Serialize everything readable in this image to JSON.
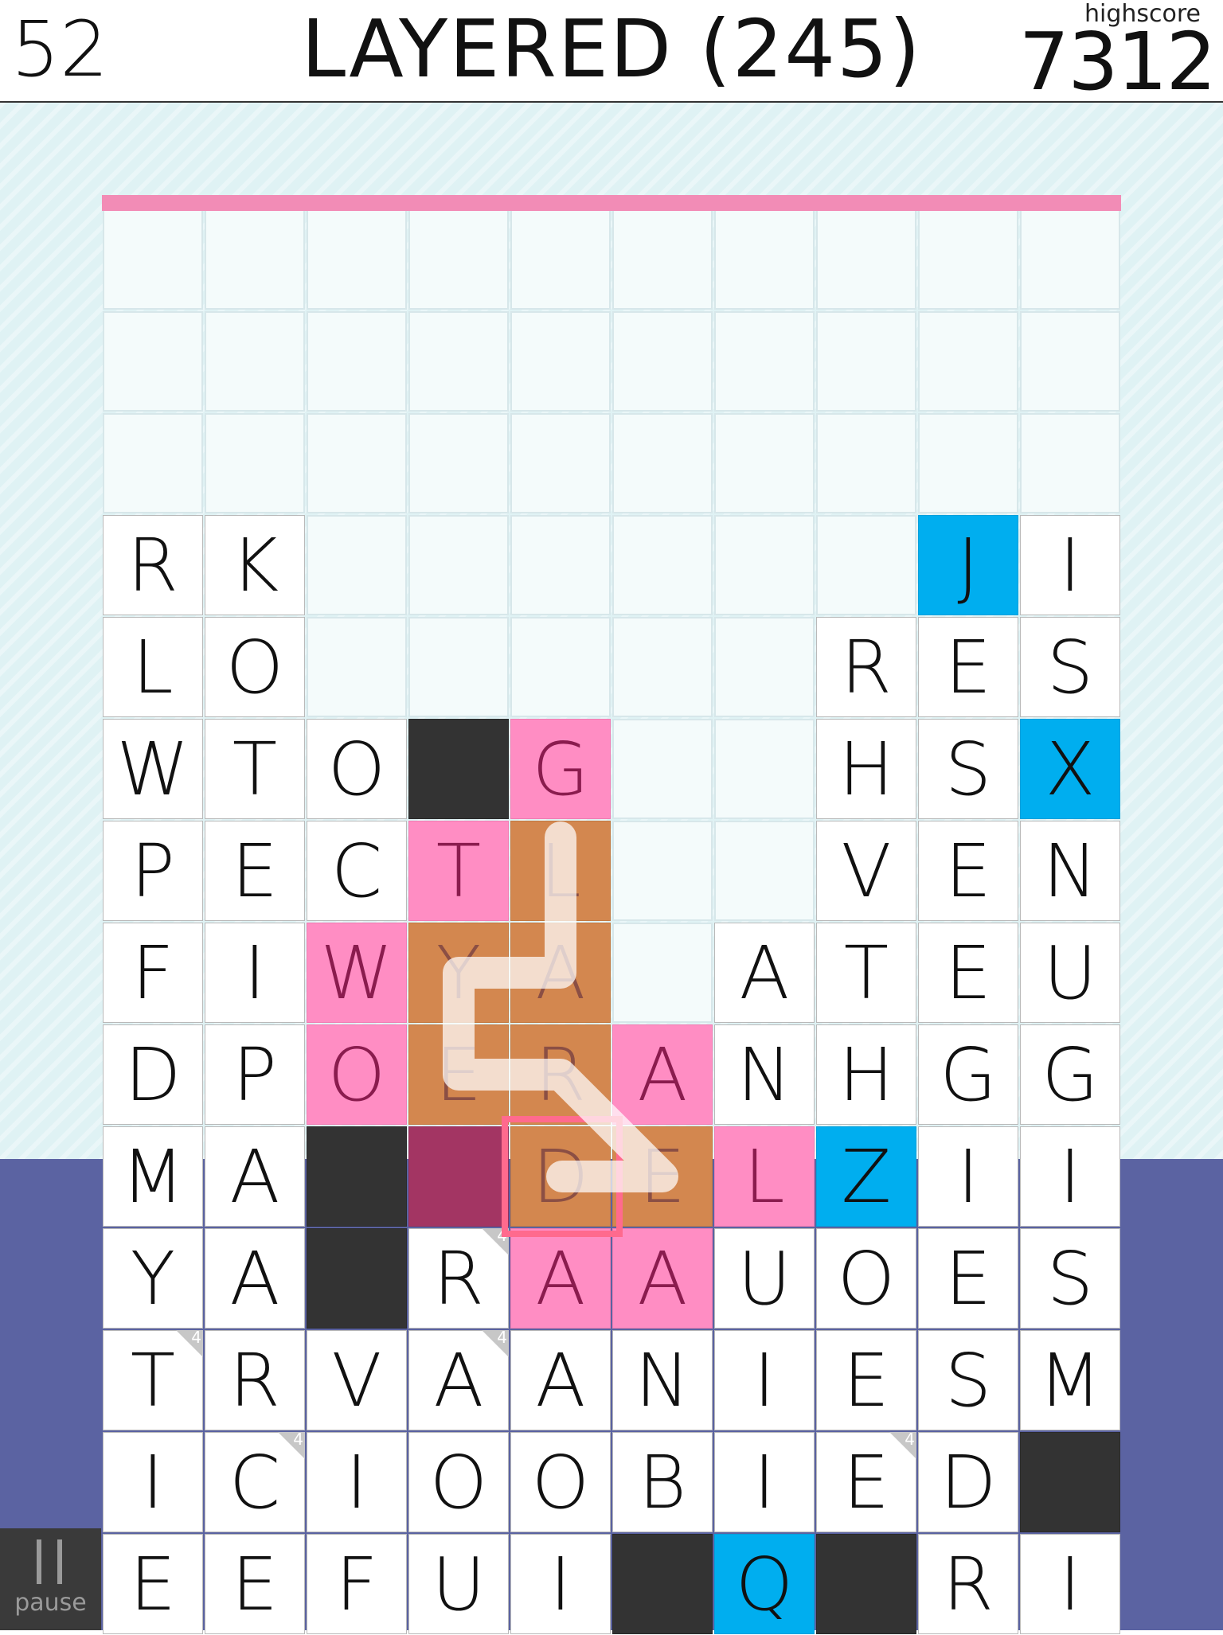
{
  "header": {
    "score": "52",
    "title": "LAYERED (245)",
    "highscore_label": "highscore",
    "highscore_value": "7312"
  },
  "pause": {
    "label": "pause",
    "icon": "pause-icon"
  },
  "colors": {
    "pink": "#ff8dc3",
    "orange": "#d3874f",
    "blue": "#00aeef",
    "black": "#333333",
    "maroon": "#a33563",
    "empty": "#f4fbfb",
    "background_top": "#dff2f4",
    "background_bottom": "#5b63a2"
  },
  "board": {
    "columns": 10,
    "rows": 14,
    "grid": [
      [
        "_",
        "_",
        "_",
        "_",
        "_",
        "_",
        "_",
        "_",
        "_",
        "_"
      ],
      [
        "_",
        "_",
        "_",
        "_",
        "_",
        "_",
        "_",
        "_",
        "_",
        "_"
      ],
      [
        "_",
        "_",
        "_",
        "_",
        "_",
        "_",
        "_",
        "_",
        "_",
        "_"
      ],
      [
        "R",
        "K",
        "_",
        "_",
        "_",
        "_",
        "_",
        "_",
        "J",
        "I"
      ],
      [
        "L",
        "O",
        "_",
        "_",
        "_",
        "_",
        "_",
        "R",
        "E",
        "S"
      ],
      [
        "W",
        "T",
        "O",
        "",
        "G",
        "_",
        "_",
        "H",
        "S",
        "X"
      ],
      [
        "P",
        "E",
        "C",
        "T",
        "L",
        "_",
        "_",
        "V",
        "E",
        "N"
      ],
      [
        "F",
        "I",
        "W",
        "Y",
        "A",
        "_",
        "A",
        "T",
        "E",
        "U"
      ],
      [
        "D",
        "P",
        "O",
        "E",
        "R",
        "A",
        "N",
        "H",
        "G",
        "G"
      ],
      [
        "M",
        "A",
        "",
        "",
        "D",
        "E",
        "L",
        "Z",
        "I",
        "I"
      ],
      [
        "Y",
        "A",
        "",
        "R",
        "A",
        "A",
        "U",
        "O",
        "E",
        "S"
      ],
      [
        "T",
        "R",
        "V",
        "A",
        "A",
        "N",
        "I",
        "E",
        "S",
        "M"
      ],
      [
        "I",
        "C",
        "I",
        "O",
        "O",
        "B",
        "I",
        "E",
        "D",
        ""
      ],
      [
        "E",
        "E",
        "F",
        "U",
        "I",
        "",
        "Q",
        "",
        "R",
        "I"
      ]
    ],
    "styles": [
      [
        "e",
        "e",
        "e",
        "e",
        "e",
        "e",
        "e",
        "e",
        "e",
        "e"
      ],
      [
        "e",
        "e",
        "e",
        "e",
        "e",
        "e",
        "e",
        "e",
        "e",
        "e"
      ],
      [
        "e",
        "e",
        "e",
        "e",
        "e",
        "e",
        "e",
        "e",
        "e",
        "e"
      ],
      [
        "w",
        "w",
        "e",
        "e",
        "e",
        "e",
        "e",
        "e",
        "b",
        "w"
      ],
      [
        "w",
        "w",
        "e",
        "e",
        "e",
        "e",
        "e",
        "w",
        "w",
        "w"
      ],
      [
        "w",
        "w",
        "w",
        "k",
        "p",
        "e",
        "e",
        "w",
        "w",
        "b"
      ],
      [
        "w",
        "w",
        "w",
        "p",
        "o",
        "e",
        "e",
        "w",
        "w",
        "w"
      ],
      [
        "w",
        "w",
        "p",
        "o",
        "o",
        "e",
        "w",
        "w",
        "w",
        "w"
      ],
      [
        "w",
        "w",
        "p",
        "o",
        "o",
        "p",
        "w",
        "w",
        "w",
        "w"
      ],
      [
        "w",
        "w",
        "k",
        "m",
        "o",
        "o",
        "p",
        "b",
        "w",
        "w"
      ],
      [
        "w",
        "w",
        "k",
        "w",
        "p",
        "p",
        "w",
        "w",
        "w",
        "w"
      ],
      [
        "w",
        "w",
        "w",
        "w",
        "w",
        "w",
        "w",
        "w",
        "w",
        "w"
      ],
      [
        "w",
        "w",
        "w",
        "w",
        "w",
        "w",
        "w",
        "w",
        "w",
        "k"
      ],
      [
        "w",
        "w",
        "w",
        "w",
        "w",
        "k",
        "b",
        "k",
        "w",
        "w"
      ]
    ],
    "bonus_tiles": [
      {
        "row": 10,
        "col": 3,
        "value": "4"
      },
      {
        "row": 11,
        "col": 0,
        "value": "4"
      },
      {
        "row": 11,
        "col": 3,
        "value": "4"
      },
      {
        "row": 12,
        "col": 1,
        "value": "4"
      },
      {
        "row": 12,
        "col": 7,
        "value": "4"
      }
    ],
    "selected_cell": {
      "row": 9,
      "col": 4
    },
    "trace_path": [
      {
        "row": 6,
        "col": 4
      },
      {
        "row": 7,
        "col": 4
      },
      {
        "row": 7,
        "col": 3
      },
      {
        "row": 8,
        "col": 3
      },
      {
        "row": 8,
        "col": 4
      },
      {
        "row": 9,
        "col": 5
      },
      {
        "row": 9,
        "col": 4
      }
    ]
  }
}
